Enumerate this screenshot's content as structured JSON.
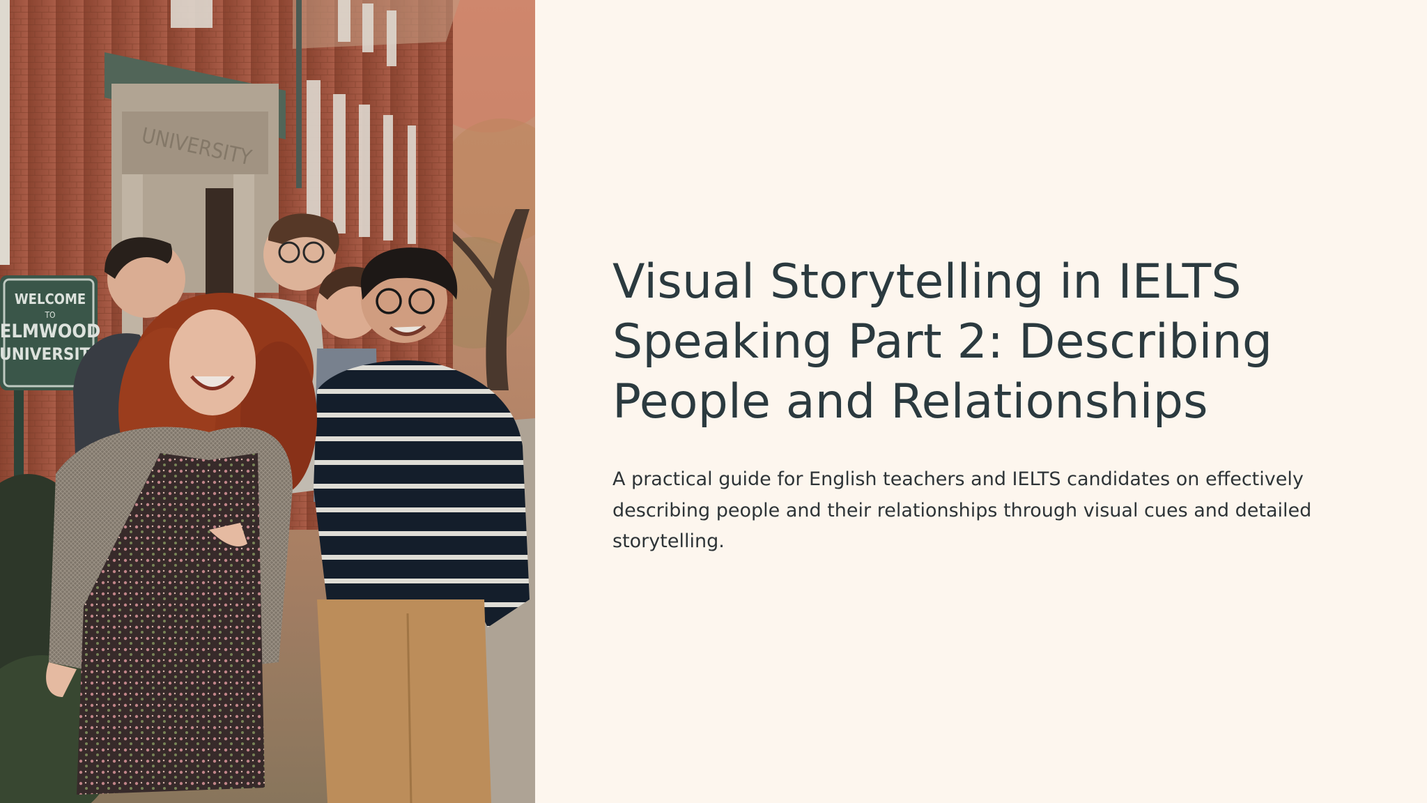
{
  "slide": {
    "title": "Visual Storytelling in IELTS Speaking Part 2: Describing People and Relationships",
    "subtitle": "A practical guide for English teachers and IELTS candidates on effectively describing people and their relationships through visual cues and detailed storytelling."
  },
  "photo": {
    "sign_line1": "WELCOME",
    "sign_line2": "TO",
    "sign_line3": "ELMWOOD",
    "sign_line4": "UNIVERSITY",
    "lintel_text": "UNIVERSITY"
  },
  "colors": {
    "background": "#fdf6ee",
    "title": "#2b3a3f",
    "body": "#2e3437",
    "brick": "#9c4f38",
    "sign": "#3d5a4c"
  }
}
